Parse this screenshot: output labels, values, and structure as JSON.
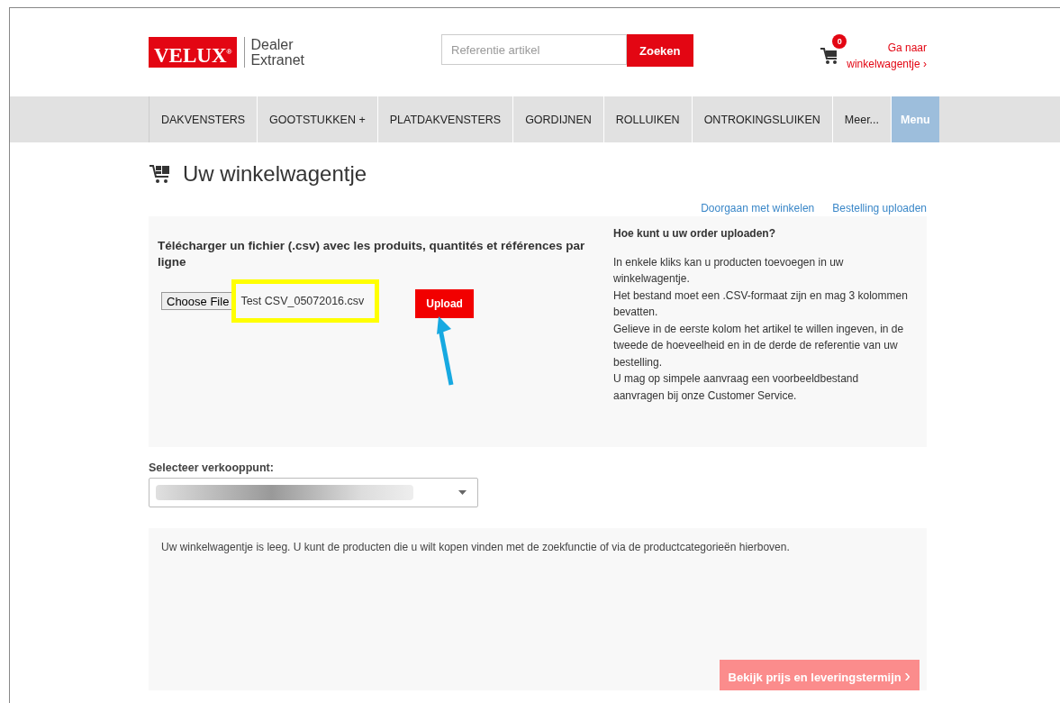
{
  "header": {
    "logo": "VELUX",
    "logo_mark": "®",
    "product": [
      "Dealer",
      "Extranet"
    ],
    "search": {
      "placeholder": "Referentie artikel",
      "button": "Zoeken"
    },
    "cart": {
      "count": "0",
      "link": [
        "Ga naar",
        "winkelwagentje"
      ],
      "chevron": "›"
    }
  },
  "nav": [
    {
      "label": "DAKVENSTERS",
      "kind": "category"
    },
    {
      "label": "GOOTSTUKKEN +",
      "kind": "category"
    },
    {
      "label": "PLATDAKVENSTERS",
      "kind": "category"
    },
    {
      "label": "GORDIJNEN",
      "kind": "category"
    },
    {
      "label": "ROLLUIKEN",
      "kind": "category"
    },
    {
      "label": "ONTROKINGSLUIKEN",
      "kind": "category"
    },
    {
      "label": "Meer...",
      "kind": "more"
    },
    {
      "label": "Menu",
      "kind": "menu"
    }
  ],
  "page_title": "Uw winkelwagentje",
  "links": [
    "Doorgaan met winkelen",
    "Bestelling uploaden"
  ],
  "upload": {
    "heading": "Télécharger un fichier (.csv) avec les produits, quantités et références par ligne",
    "choose_button": "Choose File",
    "file_name": "Test CSV_05072016.csv",
    "file_highlighted": true,
    "upload_button": "Upload",
    "arrow_to_upload": true
  },
  "help": {
    "title": "Hoe kunt u uw order uploaden?",
    "lines": [
      "In enkele kliks kan u producten toevoegen in uw winkelwagentje.",
      "Het bestand moet een .CSV-formaat zijn en mag 3 kolommen bevatten.",
      "Gelieve in de eerste kolom het artikel te willen ingeven, in de tweede de hoeveelheid en in de derde de referentie van uw bestelling.",
      "U mag op simpele aanvraag een voorbeeldbestand aanvragen bij onze Customer Service."
    ]
  },
  "point_of_sale": {
    "label": "Selecteer verkooppunt:",
    "value_blurred": true
  },
  "cart_message": "Uw winkelwagentje is leeg. U kunt de producten die u wilt kopen vinden met de zoekfunctie of via de productcategorieën hierboven.",
  "checkout": {
    "label": "Bekijk prijs en leveringstermijn",
    "chevron": "›",
    "disabled": true
  }
}
